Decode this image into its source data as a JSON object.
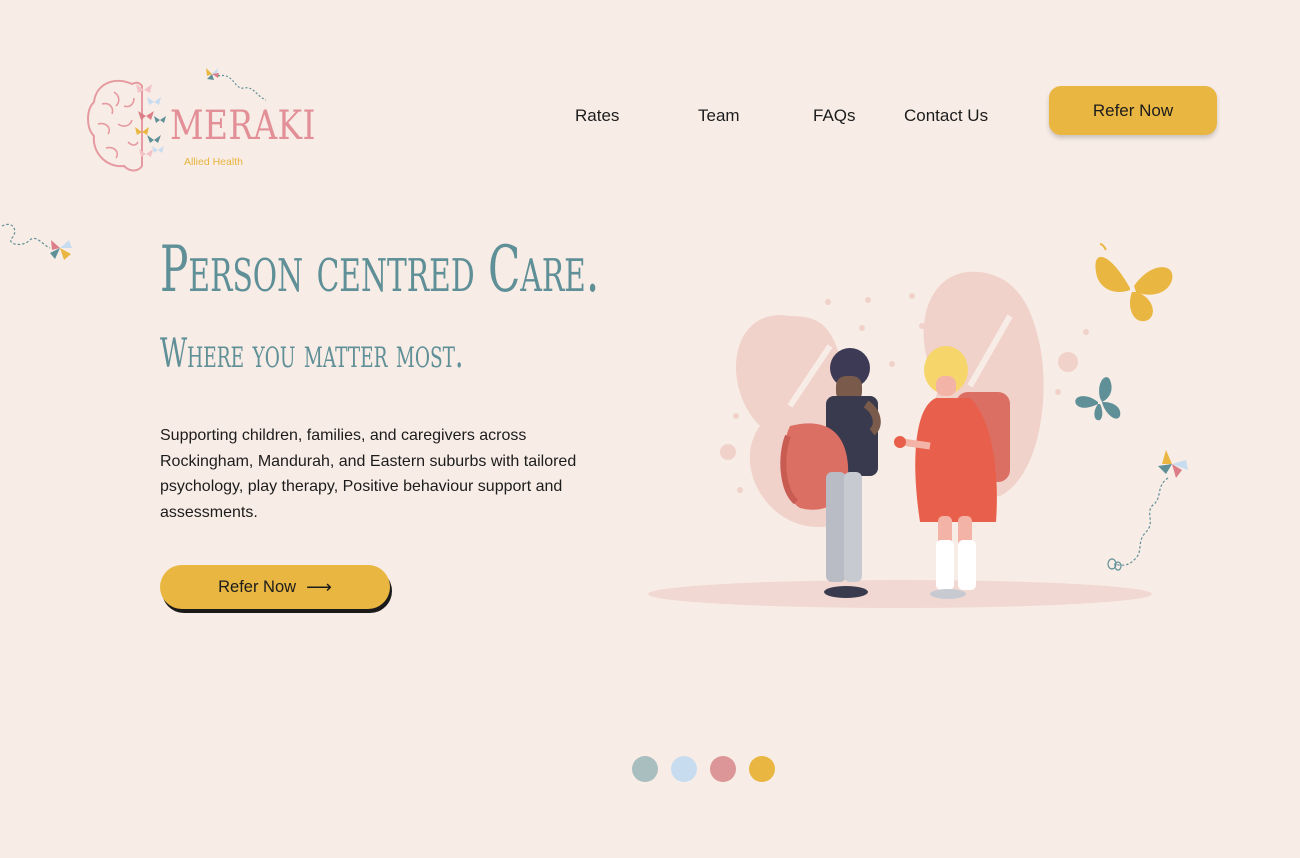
{
  "logo": {
    "name": "MERAKI",
    "tagline": "Allied Health"
  },
  "nav": {
    "items": [
      {
        "label": "Rates"
      },
      {
        "label": "Team"
      },
      {
        "label": "FAQs"
      },
      {
        "label": "Contact Us"
      }
    ],
    "cta_label": "Refer Now"
  },
  "hero": {
    "title": "Person centred Care.",
    "subtitle": "Where you matter most.",
    "description": "Supporting children, families, and caregivers across Rockingham, Mandurah, and Eastern suburbs with tailored psychology, play therapy, Positive behaviour support and assessments.",
    "cta_label": "Refer Now",
    "cta_icon": "arrow-right-icon"
  },
  "carousel": {
    "dots": [
      {
        "color": "#a9bebf"
      },
      {
        "color": "#c8dcf0"
      },
      {
        "color": "#dc9698"
      },
      {
        "color": "#e9b641"
      }
    ]
  },
  "colors": {
    "background": "#f8ede6",
    "accent_yellow": "#e9b641",
    "teal": "#5f8f97",
    "pink": "#e28f97"
  }
}
